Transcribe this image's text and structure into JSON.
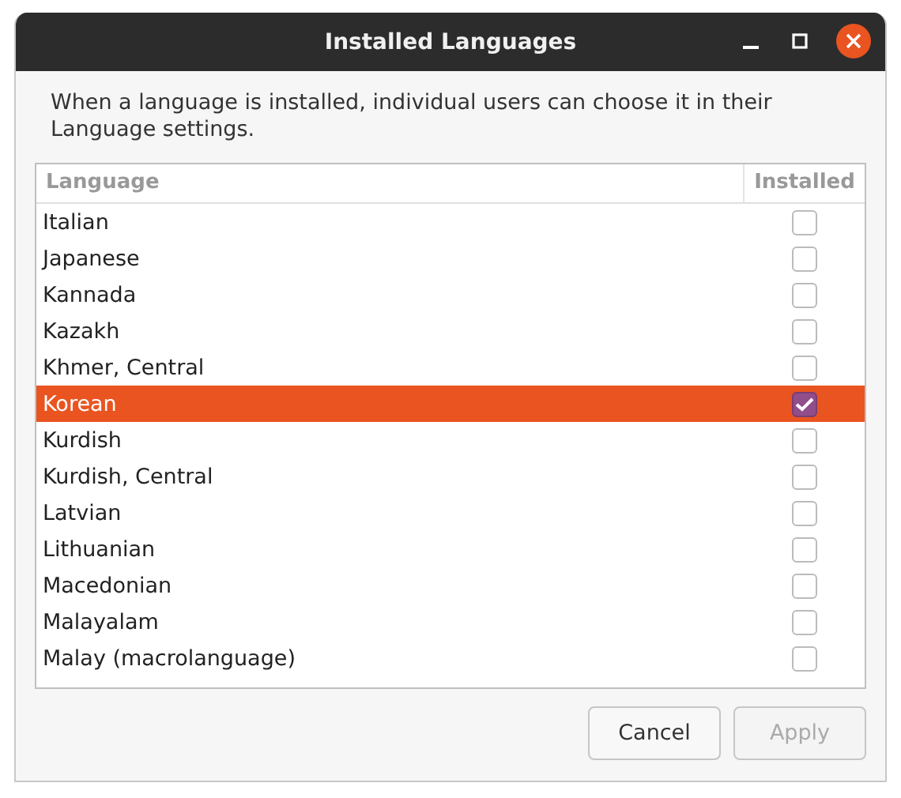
{
  "window": {
    "title": "Installed Languages"
  },
  "description": "When a language is installed, individual users can choose it in their Language settings.",
  "table": {
    "columns": [
      "Language",
      "Installed"
    ],
    "rows": [
      {
        "language": "Italian",
        "installed": false,
        "selected": false
      },
      {
        "language": "Japanese",
        "installed": false,
        "selected": false
      },
      {
        "language": "Kannada",
        "installed": false,
        "selected": false
      },
      {
        "language": "Kazakh",
        "installed": false,
        "selected": false
      },
      {
        "language": "Khmer, Central",
        "installed": false,
        "selected": false
      },
      {
        "language": "Korean",
        "installed": true,
        "selected": true
      },
      {
        "language": "Kurdish",
        "installed": false,
        "selected": false
      },
      {
        "language": "Kurdish, Central",
        "installed": false,
        "selected": false
      },
      {
        "language": "Latvian",
        "installed": false,
        "selected": false
      },
      {
        "language": "Lithuanian",
        "installed": false,
        "selected": false
      },
      {
        "language": "Macedonian",
        "installed": false,
        "selected": false
      },
      {
        "language": "Malayalam",
        "installed": false,
        "selected": false
      },
      {
        "language": "Malay (macrolanguage)",
        "installed": false,
        "selected": false
      }
    ]
  },
  "buttons": [
    {
      "label": "Cancel",
      "disabled": false
    },
    {
      "label": "Apply",
      "disabled": true
    }
  ]
}
